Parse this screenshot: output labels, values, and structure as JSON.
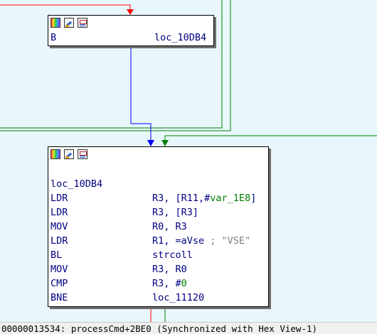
{
  "colors": {
    "background": "#e8f7fb",
    "edge_red": "#ff0000",
    "edge_blue": "#0000ff",
    "edge_green": "#008000",
    "text": "#000080",
    "comment": "#808080"
  },
  "node_top": {
    "toolbar_icons": [
      "color-palette-icon",
      "rename-edit-icon",
      "group-nodes-icon"
    ],
    "mnemonic": "B",
    "operand": "loc_10DB4"
  },
  "node_main": {
    "toolbar_icons": [
      "color-palette-icon",
      "rename-edit-icon",
      "group-nodes-icon"
    ],
    "label": "loc_10DB4",
    "instructions": [
      {
        "mnemonic": "LDR",
        "operand": "R3, [R11,#",
        "var": "var_1E8",
        "suffix": "]",
        "comment": ""
      },
      {
        "mnemonic": "LDR",
        "operand": "R3, [R3]",
        "var": "",
        "suffix": "",
        "comment": ""
      },
      {
        "mnemonic": "MOV",
        "operand": "R0, R3",
        "var": "",
        "suffix": "",
        "comment": ""
      },
      {
        "mnemonic": "LDR",
        "operand": "R1, =aVse ",
        "var": "",
        "suffix": "",
        "comment": "; \"VSE\""
      },
      {
        "mnemonic": "BL",
        "operand": "strcoll",
        "var": "",
        "suffix": "",
        "comment": ""
      },
      {
        "mnemonic": "MOV",
        "operand": "R3, R0",
        "var": "",
        "suffix": "",
        "comment": ""
      },
      {
        "mnemonic": "CMP",
        "operand": "R3, #",
        "var": "0",
        "suffix": "",
        "comment": ""
      },
      {
        "mnemonic": "BNE",
        "operand": "loc_11120",
        "var": "",
        "suffix": "",
        "comment": ""
      }
    ]
  },
  "status": {
    "address": "00000013534: processCmd+2BE0",
    "sync": "(Synchronized with Hex View-1)"
  }
}
